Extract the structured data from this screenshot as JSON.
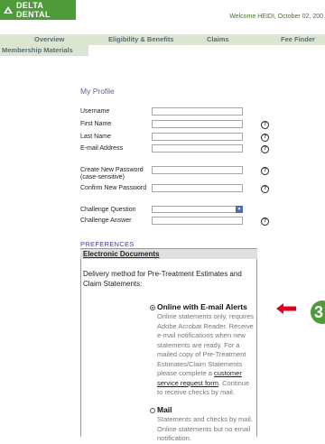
{
  "header": {
    "logo_text": "DELTA DENTAL",
    "welcome_text": "Welcome HEIDI, October 02, 200"
  },
  "nav": {
    "items": [
      {
        "label": "Overview"
      },
      {
        "label": "Eligibility & Benefits"
      },
      {
        "label": "Claims"
      },
      {
        "label": "Fee Finder"
      }
    ],
    "sub_item": "Membership Materials"
  },
  "profile": {
    "title": "My Profile",
    "help_glyph": "?",
    "fields": {
      "username": {
        "label": "Username",
        "value": ""
      },
      "first_name": {
        "label": "First Name",
        "value": ""
      },
      "last_name": {
        "label": "Last Name",
        "value": ""
      },
      "email": {
        "label": "E-mail Address",
        "value": ""
      },
      "new_password": {
        "label": "Create New Password",
        "sublabel": "(case-sensitive)",
        "value": ""
      },
      "confirm_password": {
        "label": "Confirm New Password",
        "value": ""
      },
      "challenge_question": {
        "label": "Challenge Question",
        "value": ""
      },
      "challenge_answer": {
        "label": "Challenge Answer",
        "value": ""
      }
    }
  },
  "preferences": {
    "label": "PREFERENCES",
    "section_title": "Electronic Documents",
    "delivery_text": "Delivery method for Pre-Treatment Estimates and Claim Statements:",
    "options": [
      {
        "label": "Online with E-mail Alerts",
        "selected": true,
        "desc_before": "Online statements only, requires Adobe Acrobat Reader. Receive e-mail notifications when new statements are ready. For a mailed copy of Pre-Treatment Estimates/Claim Statements please complete a ",
        "link_text": "customer service request form",
        "desc_after": ". Continue to receive checks by mail."
      },
      {
        "label": "Mail",
        "selected": false,
        "desc": "Statements and checks by mail. Online statements but no email notification."
      }
    ]
  },
  "callout": {
    "step_number": "3",
    "arrow_color": "#e0001b",
    "badge_color": "#4f9b3a"
  },
  "colors": {
    "brand_green": "#4f9b3a",
    "nav_bg": "#dbe6d2",
    "nav_text": "#5c6b78",
    "profile_title": "#6a5a9a"
  }
}
